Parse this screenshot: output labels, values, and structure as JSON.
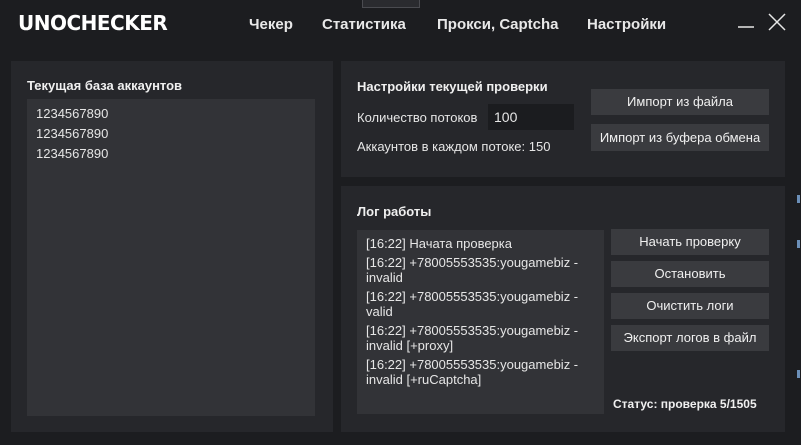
{
  "app": {
    "logo": "UNOCHECKER"
  },
  "nav": [
    "Чекер",
    "Статистика",
    "Прокси, Captcha",
    "Настройки"
  ],
  "window": {
    "minimize_icon": "minimize-icon",
    "close_icon": "close-icon"
  },
  "db": {
    "title": "Текущая база аккаунтов",
    "accounts": [
      "1234567890",
      "1234567890",
      "1234567890"
    ]
  },
  "settings": {
    "title": "Настройки текущей проверки",
    "threads_label": "Количество потоков",
    "threads_value": "100",
    "per_thread_label": "Аккаунтов в каждом потоке: 150",
    "import_file": "Импорт из файла",
    "import_clipboard": "Импорт из буфера обмена"
  },
  "log": {
    "title": "Лог работы",
    "entries": [
      "[16:22]  Начата проверка",
      "[16:22] +78005553535:yougamebiz - invalid",
      "[16:22] +78005553535:yougamebiz - valid",
      "[16:22] +78005553535:yougamebiz - invalid [+proxy]",
      "[16:22] +78005553535:yougamebiz - invalid [+ruCaptcha]"
    ],
    "start": "Начать проверку",
    "stop": "Остановить",
    "clear": "Очистить логи",
    "export": "Экспорт логов в файл",
    "status": "Статус: проверка 5/1505"
  },
  "colors": {
    "background": "#1c1d20",
    "panel": "#26272b",
    "field": "#323337",
    "button": "#3a3b3f"
  }
}
